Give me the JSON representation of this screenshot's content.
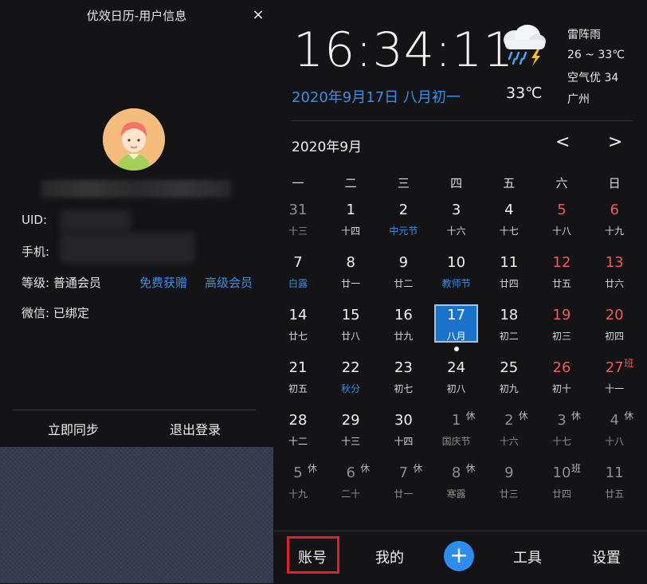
{
  "left": {
    "title": "优效日历-用户信息",
    "close": "×",
    "uid_label": "UID:",
    "phone_label": "手机:",
    "level_label": "等级:",
    "level_value": "普通会员",
    "free_link": "免费获赠",
    "premium_link": "高级会员",
    "wechat_label": "微信:",
    "wechat_value": "已绑定",
    "sync_button": "立即同步",
    "logout_button": "退出登录"
  },
  "header": {
    "time": "16:34:11",
    "date": "2020年9月17日 八月初一",
    "temp_now": "33℃",
    "weather": "雷阵雨",
    "temp_range": "26 ~ 33℃",
    "air": "空气优 34",
    "city": "广州",
    "weather_icon": "thunderstorm-icon"
  },
  "calendar": {
    "month_title": "2020年9月",
    "prev": "<",
    "next": ">",
    "weekdays": [
      "一",
      "二",
      "三",
      "四",
      "五",
      "六",
      "日"
    ],
    "weeks": [
      [
        {
          "d": "31",
          "l": "十三",
          "other": true
        },
        {
          "d": "1",
          "l": "十四"
        },
        {
          "d": "2",
          "l": "中元节",
          "blue": true
        },
        {
          "d": "3",
          "l": "十六"
        },
        {
          "d": "4",
          "l": "十七"
        },
        {
          "d": "5",
          "l": "十八",
          "weekend": true
        },
        {
          "d": "6",
          "l": "十九",
          "weekend": true
        }
      ],
      [
        {
          "d": "7",
          "l": "白露",
          "blue": true
        },
        {
          "d": "8",
          "l": "廿一"
        },
        {
          "d": "9",
          "l": "廿二"
        },
        {
          "d": "10",
          "l": "教师节",
          "blue": true
        },
        {
          "d": "11",
          "l": "廿四"
        },
        {
          "d": "12",
          "l": "廿五",
          "weekend": true
        },
        {
          "d": "13",
          "l": "廿六",
          "weekend": true
        }
      ],
      [
        {
          "d": "14",
          "l": "廿七"
        },
        {
          "d": "15",
          "l": "廿八"
        },
        {
          "d": "16",
          "l": "廿九"
        },
        {
          "d": "17",
          "l": "八月",
          "today": true
        },
        {
          "d": "18",
          "l": "初二"
        },
        {
          "d": "19",
          "l": "初三",
          "weekend": true
        },
        {
          "d": "20",
          "l": "初四",
          "weekend": true
        }
      ],
      [
        {
          "d": "21",
          "l": "初五"
        },
        {
          "d": "22",
          "l": "秋分",
          "blue": true
        },
        {
          "d": "23",
          "l": "初七"
        },
        {
          "d": "24",
          "l": "初八"
        },
        {
          "d": "25",
          "l": "初九"
        },
        {
          "d": "26",
          "l": "初十",
          "weekend": true
        },
        {
          "d": "27",
          "l": "十一",
          "weekend": true,
          "tag": "班",
          "tagRed": true
        }
      ],
      [
        {
          "d": "28",
          "l": "十二"
        },
        {
          "d": "29",
          "l": "十三"
        },
        {
          "d": "30",
          "l": "十四"
        },
        {
          "d": "1",
          "l": "国庆节",
          "other": true,
          "tag": "休"
        },
        {
          "d": "2",
          "l": "十六",
          "other": true,
          "tag": "休"
        },
        {
          "d": "3",
          "l": "十七",
          "other": true,
          "tag": "休"
        },
        {
          "d": "4",
          "l": "十八",
          "other": true,
          "tag": "休"
        }
      ],
      [
        {
          "d": "5",
          "l": "十九",
          "other": true,
          "tag": "休"
        },
        {
          "d": "6",
          "l": "二十",
          "other": true,
          "tag": "休"
        },
        {
          "d": "7",
          "l": "廿一",
          "other": true,
          "tag": "休"
        },
        {
          "d": "8",
          "l": "寒露",
          "other": true,
          "tag": "休"
        },
        {
          "d": "9",
          "l": "廿三",
          "other": true
        },
        {
          "d": "10",
          "l": "廿四",
          "other": true,
          "tag": "班"
        },
        {
          "d": "11",
          "l": "廿五",
          "other": true
        }
      ]
    ]
  },
  "tabs": {
    "account": "账号",
    "mine": "我的",
    "add": "+",
    "tools": "工具",
    "settings": "设置"
  }
}
